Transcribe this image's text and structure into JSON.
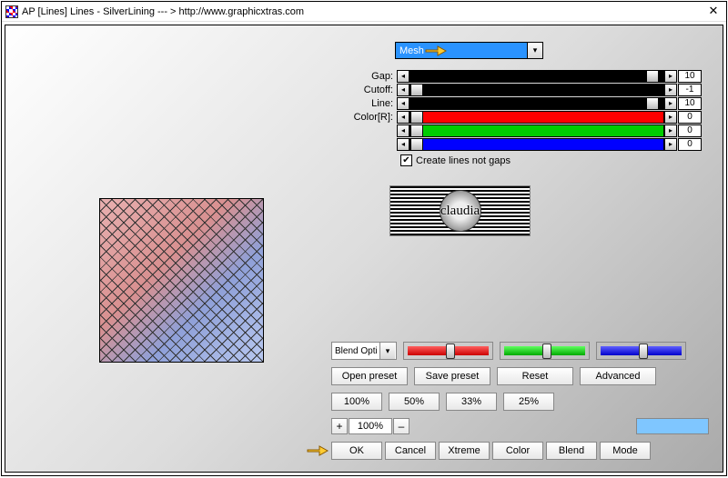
{
  "title": "AP [Lines]  Lines - SilverLining    --- >  http://www.graphicxtras.com",
  "dropdown": {
    "value": "Mesh"
  },
  "sliders": [
    {
      "label": "Gap:",
      "value": "10",
      "color": "black",
      "thumb": 0.98
    },
    {
      "label": "Cutoff:",
      "value": "-1",
      "color": "black",
      "thumb": 0.0
    },
    {
      "label": "Line:",
      "value": "10",
      "color": "black",
      "thumb": 0.98
    },
    {
      "label": "Color[R]:",
      "value": "0",
      "color": "red",
      "thumb": 0.0
    },
    {
      "label": "",
      "value": "0",
      "color": "green",
      "thumb": 0.0
    },
    {
      "label": "",
      "value": "0",
      "color": "blue",
      "thumb": 0.0
    }
  ],
  "checkbox": {
    "label": "Create lines not gaps",
    "checked": true
  },
  "logo_text": "claudia",
  "blend_options_label": "Blend Opti",
  "preset_buttons": {
    "open": "Open preset",
    "save": "Save preset",
    "reset": "Reset",
    "advanced": "Advanced"
  },
  "percent_buttons": [
    "100%",
    "50%",
    "33%",
    "25%"
  ],
  "zoom": {
    "plus": "+",
    "value": "100%",
    "minus": "–"
  },
  "actions": [
    "OK",
    "Cancel",
    "Xtreme",
    "Color",
    "Blend",
    "Mode"
  ]
}
